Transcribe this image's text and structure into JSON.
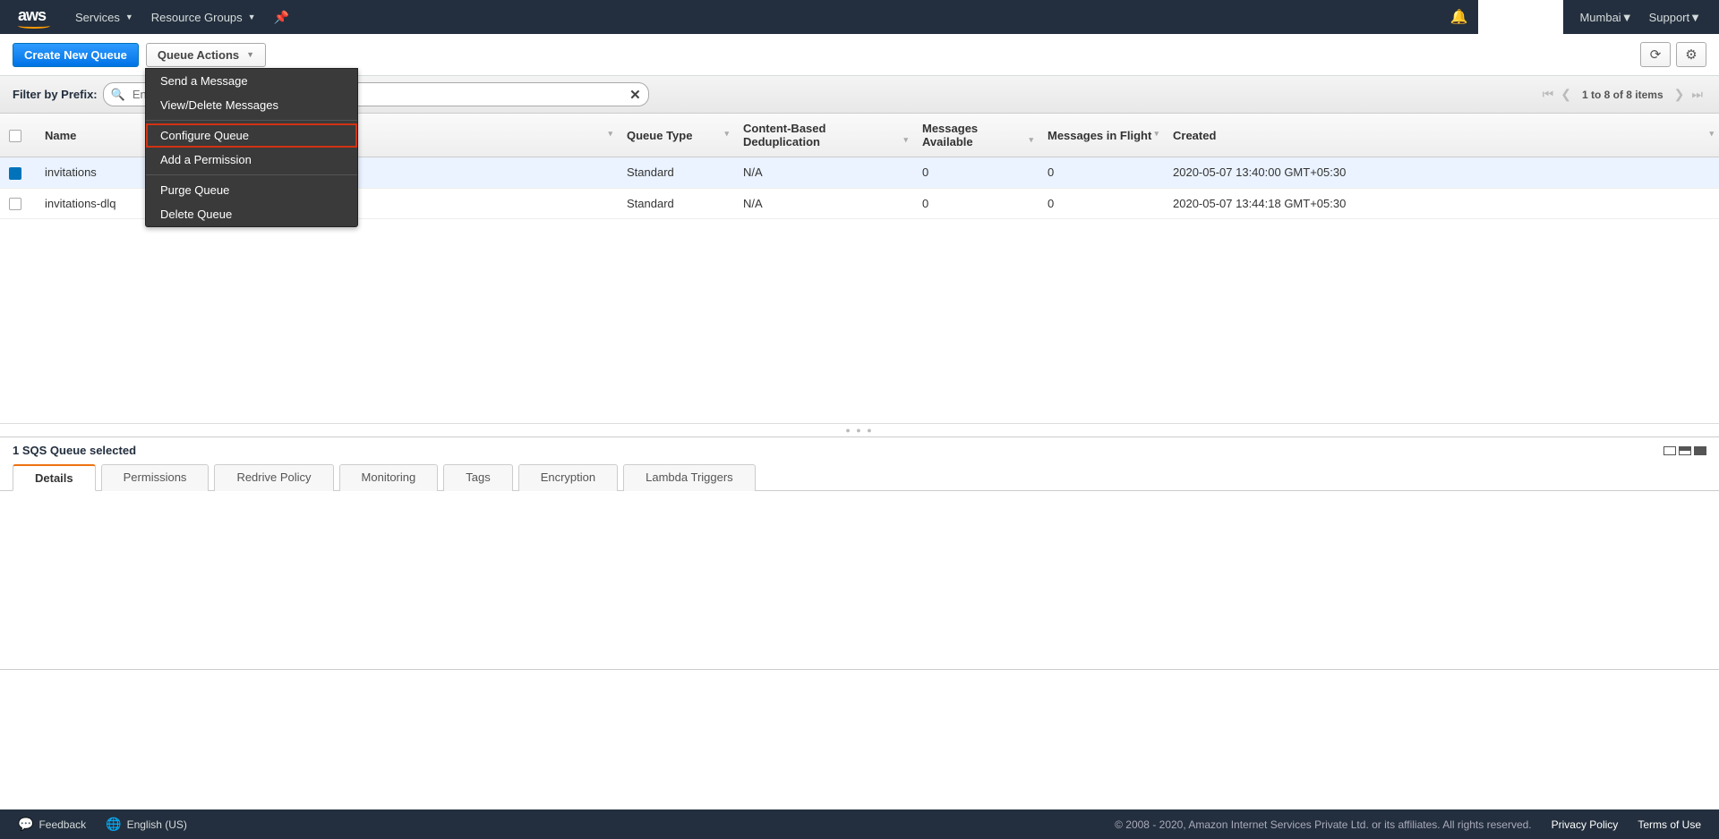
{
  "nav": {
    "services": "Services",
    "resource_groups": "Resource Groups",
    "region": "Mumbai",
    "support": "Support"
  },
  "actions": {
    "create": "Create New Queue",
    "queue_actions": "Queue Actions"
  },
  "dropdown": {
    "send": "Send a Message",
    "view_delete": "View/Delete Messages",
    "configure": "Configure Queue",
    "add_permission": "Add a Permission",
    "purge": "Purge Queue",
    "delete": "Delete Queue"
  },
  "filter": {
    "label": "Filter by Prefix:",
    "placeholder": "En",
    "pager": "1 to 8 of 8 items"
  },
  "columns": {
    "name": "Name",
    "type": "Queue Type",
    "dedup": "Content-Based Deduplication",
    "avail": "Messages Available",
    "flight": "Messages in Flight",
    "created": "Created"
  },
  "rows": [
    {
      "name": "invitations",
      "type": "Standard",
      "dedup": "N/A",
      "avail": "0",
      "flight": "0",
      "created": "2020-05-07 13:40:00 GMT+05:30",
      "selected": true
    },
    {
      "name": "invitations-dlq",
      "type": "Standard",
      "dedup": "N/A",
      "avail": "0",
      "flight": "0",
      "created": "2020-05-07 13:44:18 GMT+05:30",
      "selected": false
    }
  ],
  "selection": "1 SQS Queue selected",
  "tabs": {
    "details": "Details",
    "permissions": "Permissions",
    "redrive": "Redrive Policy",
    "monitoring": "Monitoring",
    "tags": "Tags",
    "encryption": "Encryption",
    "lambda": "Lambda Triggers"
  },
  "footer": {
    "feedback": "Feedback",
    "language": "English (US)",
    "copyright": "© 2008 - 2020, Amazon Internet Services Private Ltd. or its affiliates. All rights reserved.",
    "privacy": "Privacy Policy",
    "terms": "Terms of Use"
  }
}
